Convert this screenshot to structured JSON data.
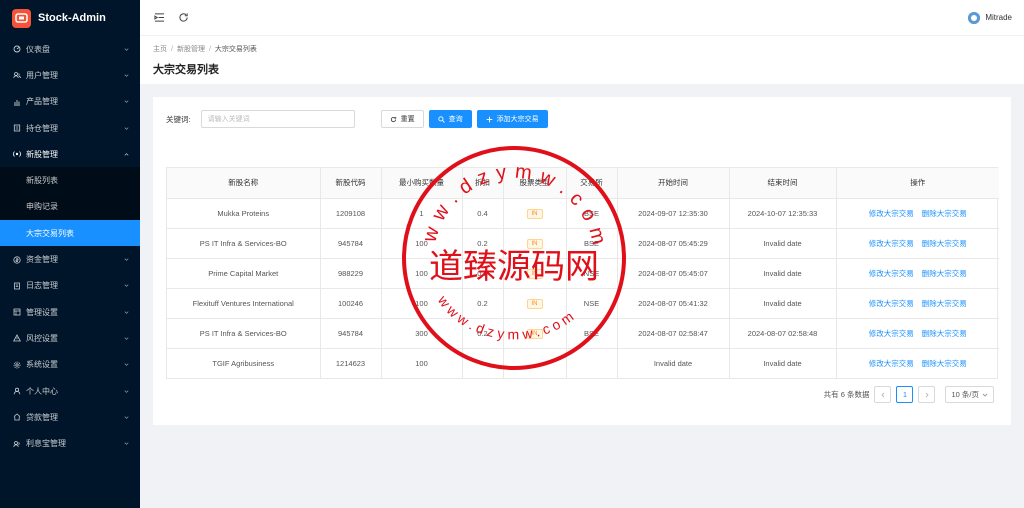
{
  "app": {
    "name": "Stock-Admin"
  },
  "sidebar": {
    "items": [
      {
        "label": "仪表盘",
        "icon": "dashboard-icon"
      },
      {
        "label": "用户管理",
        "icon": "users-icon"
      },
      {
        "label": "产品管理",
        "icon": "chart-icon"
      },
      {
        "label": "持仓管理",
        "icon": "position-icon"
      },
      {
        "label": "新股管理",
        "icon": "ipo-icon",
        "open": true
      },
      {
        "label": "资金管理",
        "icon": "money-icon"
      },
      {
        "label": "日志管理",
        "icon": "log-icon"
      },
      {
        "label": "管理设置",
        "icon": "admin-settings-icon"
      },
      {
        "label": "风控设置",
        "icon": "warning-icon"
      },
      {
        "label": "系统设置",
        "icon": "gear-icon"
      },
      {
        "label": "个人中心",
        "icon": "user-icon"
      },
      {
        "label": "贷款管理",
        "icon": "loan-icon"
      },
      {
        "label": "利息宝管理",
        "icon": "interest-icon"
      }
    ],
    "submenu": [
      {
        "label": "新股列表"
      },
      {
        "label": "申购记录"
      },
      {
        "label": "大宗交易列表",
        "active": true
      }
    ]
  },
  "header": {
    "user_name": "Mitrade"
  },
  "breadcrumb": [
    "主页",
    "新股管理",
    "大宗交易列表"
  ],
  "page_title": "大宗交易列表",
  "search": {
    "label": "关键词:",
    "placeholder": "请输入关键词",
    "reset_label": "重置",
    "query_label": "查询",
    "add_label": "添加大宗交易"
  },
  "table": {
    "columns": [
      "新股名称",
      "新股代码",
      "最小购买数量",
      "折扣",
      "股票类型",
      "交易所",
      "开始时间",
      "结束时间",
      "操作"
    ],
    "rows": [
      [
        "Mukka Proteins",
        "1209108",
        "1",
        "0.4",
        "IN",
        "BSE",
        "2024-09-07 12:35:30",
        "2024-10-07 12:35:33"
      ],
      [
        "PS IT Infra & Services-BO",
        "945784",
        "100",
        "0.2",
        "IN",
        "BSE",
        "2024-08-07 05:45:29",
        "Invalid date"
      ],
      [
        "Prime Capital Market",
        "988229",
        "100",
        "0.2",
        "IN",
        "NSE",
        "2024-08-07 05:45:07",
        "Invalid date"
      ],
      [
        "Flexituff Ventures International",
        "100246",
        "100",
        "0.2",
        "IN",
        "NSE",
        "2024-08-07 05:41:32",
        "Invalid date"
      ],
      [
        "PS IT Infra & Services-BO",
        "945784",
        "300",
        "0.2",
        "IN",
        "BSE",
        "2024-08-07 02:58:47",
        "2024-08-07 02:58:48"
      ],
      [
        "TGIF Agribusiness",
        "1214623",
        "100",
        "",
        "",
        "",
        "Invalid date",
        "Invalid date"
      ]
    ],
    "edit_label": "修改大宗交易",
    "delete_label": "删除大宗交易"
  },
  "pagination": {
    "total_text": "共有 6 条数据",
    "current_page": "1",
    "page_size": "10 条/页"
  },
  "watermark": {
    "center_text": "道臻源码网",
    "top_text": "w w . d z y m w . c o m",
    "bottom_text": "w w w . d z y m w . c o m"
  },
  "colors": {
    "primary": "#1890ff",
    "sidebar_bg": "#001529",
    "logo": "#f5523a",
    "watermark": "#e0101a"
  }
}
